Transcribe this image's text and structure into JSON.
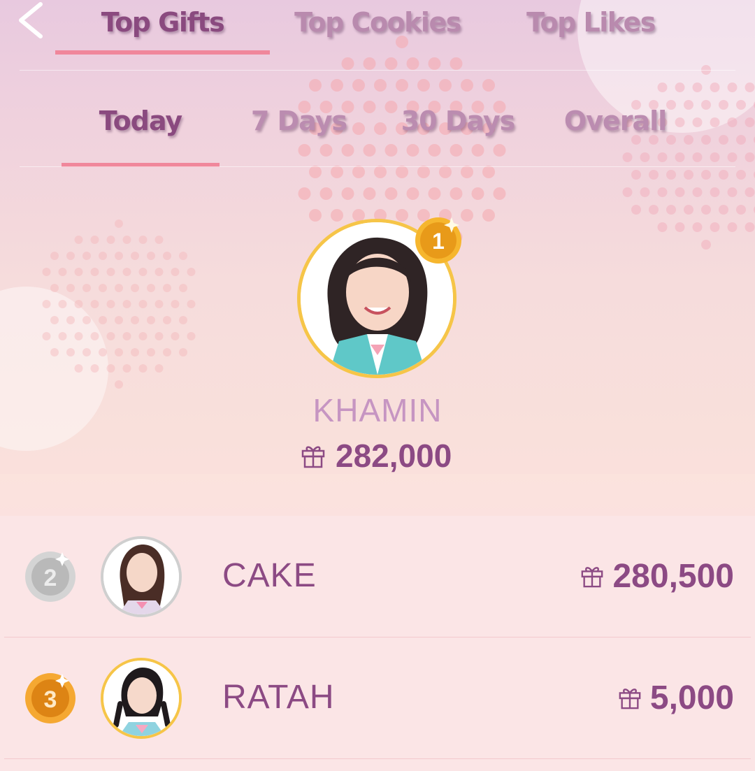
{
  "nav": {
    "back_icon": "chevron-left-icon",
    "tabs": [
      {
        "label": "Top Gifts",
        "active": true
      },
      {
        "label": "Top Cookies",
        "active": false
      },
      {
        "label": "Top Likes",
        "active": false
      }
    ]
  },
  "period_tabs": [
    {
      "label": "Today",
      "active": true
    },
    {
      "label": "7 Days",
      "active": false
    },
    {
      "label": "30 Days",
      "active": false
    },
    {
      "label": "Overall",
      "active": false
    }
  ],
  "winner": {
    "rank": "1",
    "name": "KHAMIN",
    "score": "282,000",
    "score_icon": "gift-icon",
    "medal_color": "#f6b62e"
  },
  "ranking": [
    {
      "rank": "2",
      "name": "CAKE",
      "score": "280,500",
      "score_icon": "gift-icon",
      "medal_color": "#c9c9c9"
    },
    {
      "rank": "3",
      "name": "RATAH",
      "score": "5,000",
      "score_icon": "gift-icon",
      "medal_color": "#f0a02a"
    }
  ],
  "colors": {
    "accent": "#f0879b",
    "text_primary": "#8c4a84",
    "text_muted": "#c695c2",
    "gold_ring": "#f6c548"
  }
}
